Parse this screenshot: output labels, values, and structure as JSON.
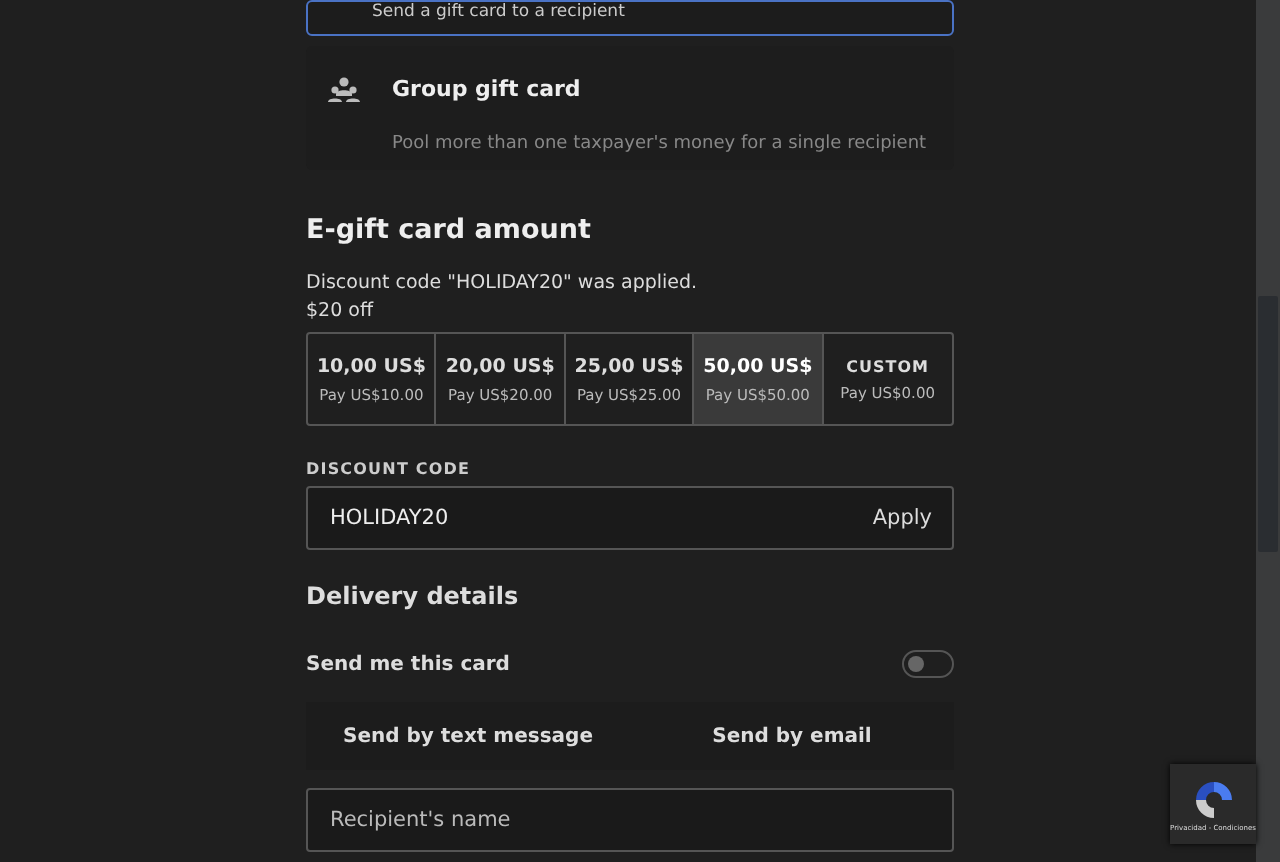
{
  "gift_types": [
    {
      "title": "Send a gift card to a recipient",
      "selected": true
    },
    {
      "title": "Group gift card",
      "description": "Pool more than one taxpayer's money for a single recipient",
      "selected": false
    }
  ],
  "amount": {
    "heading": "E-gift card amount",
    "discount_notice": "Discount code \"HOLIDAY20\" was applied.",
    "discount_off": "$20 off",
    "options": [
      {
        "kind": "fixed",
        "label": "10,00 US$",
        "pay": "Pay US$10.00",
        "selected": false
      },
      {
        "kind": "fixed",
        "label": "20,00 US$",
        "pay": "Pay US$20.00",
        "selected": false
      },
      {
        "kind": "fixed",
        "label": "25,00 US$",
        "pay": "Pay US$25.00",
        "selected": false
      },
      {
        "kind": "fixed",
        "label": "50,00 US$",
        "pay": "Pay US$50.00",
        "selected": true
      },
      {
        "kind": "custom",
        "label": "CUSTOM",
        "pay": "Pay US$0.00",
        "selected": false
      }
    ],
    "code_label": "DISCOUNT CODE",
    "code_value": "HOLIDAY20",
    "apply": "Apply"
  },
  "delivery": {
    "heading": "Delivery details",
    "send_me": "Send me this card",
    "send_me_on": false,
    "methods": [
      {
        "label": "Send by text message"
      },
      {
        "label": "Send by email"
      }
    ],
    "recipient_placeholder": "Recipient's name"
  },
  "recaptcha": {
    "text": "Privacidad - Condiciones"
  }
}
